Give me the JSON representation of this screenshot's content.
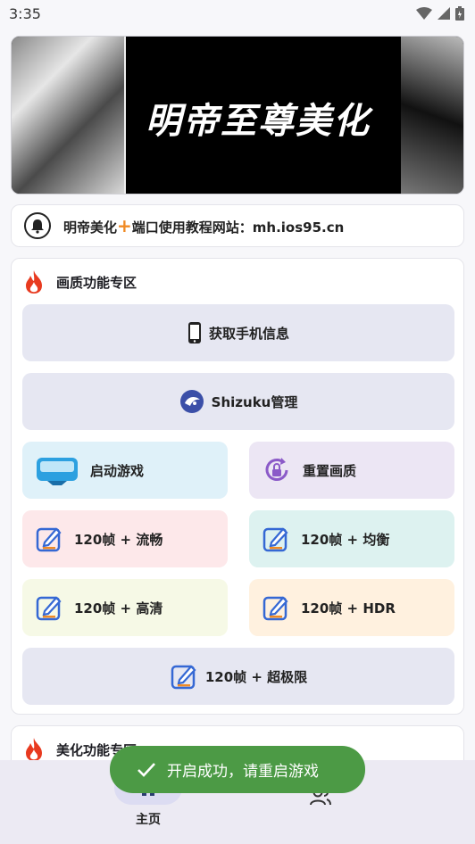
{
  "status_bar": {
    "time": "3:35"
  },
  "banner": {
    "title": "明帝至尊美化"
  },
  "notice": {
    "text_before": "明帝美化",
    "plus_symbol": "+",
    "text_after": "端口使用教程网站：mh.ios95.cn"
  },
  "section_quality": {
    "title": "画质功能专区",
    "buttons": [
      {
        "label": "获取手机信息",
        "icon": "phone-icon"
      },
      {
        "label": "Shizuku管理",
        "icon": "shizuku-icon"
      },
      {
        "label": "启动游戏",
        "icon": "vr-goggles-icon"
      },
      {
        "label": "重置画质",
        "icon": "reset-lock-icon"
      },
      {
        "label": "120帧 + 流畅",
        "icon": "edit-icon"
      },
      {
        "label": "120帧 + 均衡",
        "icon": "edit-icon"
      },
      {
        "label": "120帧 + 高清",
        "icon": "edit-icon"
      },
      {
        "label": "120帧 + HDR",
        "icon": "edit-icon"
      },
      {
        "label": "120帧 + 超极限",
        "icon": "edit-icon"
      }
    ]
  },
  "section_beauty": {
    "title": "美化功能专区"
  },
  "bottom_nav": {
    "home_label": "主页"
  },
  "toast": {
    "text": "开启成功，请重启游戏"
  },
  "colors": {
    "accent_orange": "#f08a24",
    "fire_red": "#e83a1f",
    "toast_green": "#4c9a45"
  }
}
